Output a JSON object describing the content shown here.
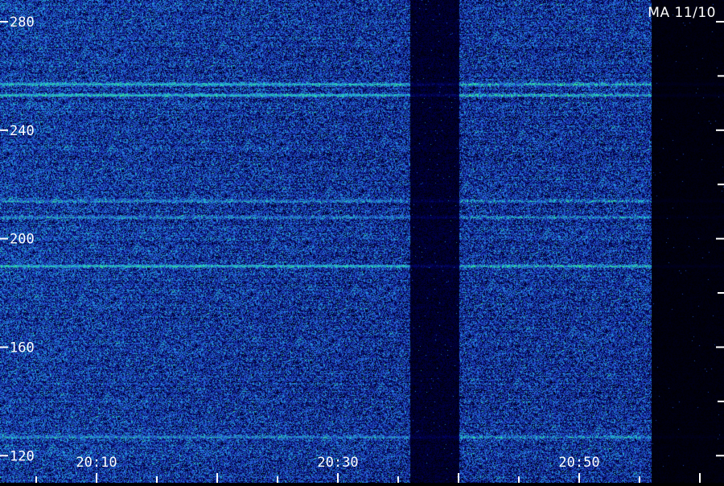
{
  "chart_data": {
    "type": "heatmap",
    "title": "MA 11/10",
    "y_ticks": [
      120,
      160,
      200,
      240,
      280
    ],
    "y_tick_labels": [
      "120",
      "160",
      "200",
      "240",
      "280"
    ],
    "x_tick_labels": [
      "20:10",
      "20:30",
      "20:50"
    ],
    "ylim": [
      110,
      288
    ],
    "xlim_minutes": [
      2,
      62
    ],
    "colormap": [
      "#000000",
      "#0a0f6e",
      "#1e2fb8",
      "#2e52d8",
      "#27b6d8",
      "#33e08a"
    ],
    "bands": [
      {
        "y": 257,
        "intensity": "high"
      },
      {
        "y": 253,
        "intensity": "high"
      },
      {
        "y": 214,
        "intensity": "medium"
      },
      {
        "y": 208,
        "intensity": "medium"
      },
      {
        "y": 190,
        "intensity": "high"
      },
      {
        "y": 127,
        "intensity": "medium"
      }
    ],
    "data_gaps": [
      {
        "from": "20:36",
        "to": "20:40",
        "level": "low"
      },
      {
        "from": "20:56",
        "to": "21:02",
        "level": "none"
      }
    ]
  }
}
